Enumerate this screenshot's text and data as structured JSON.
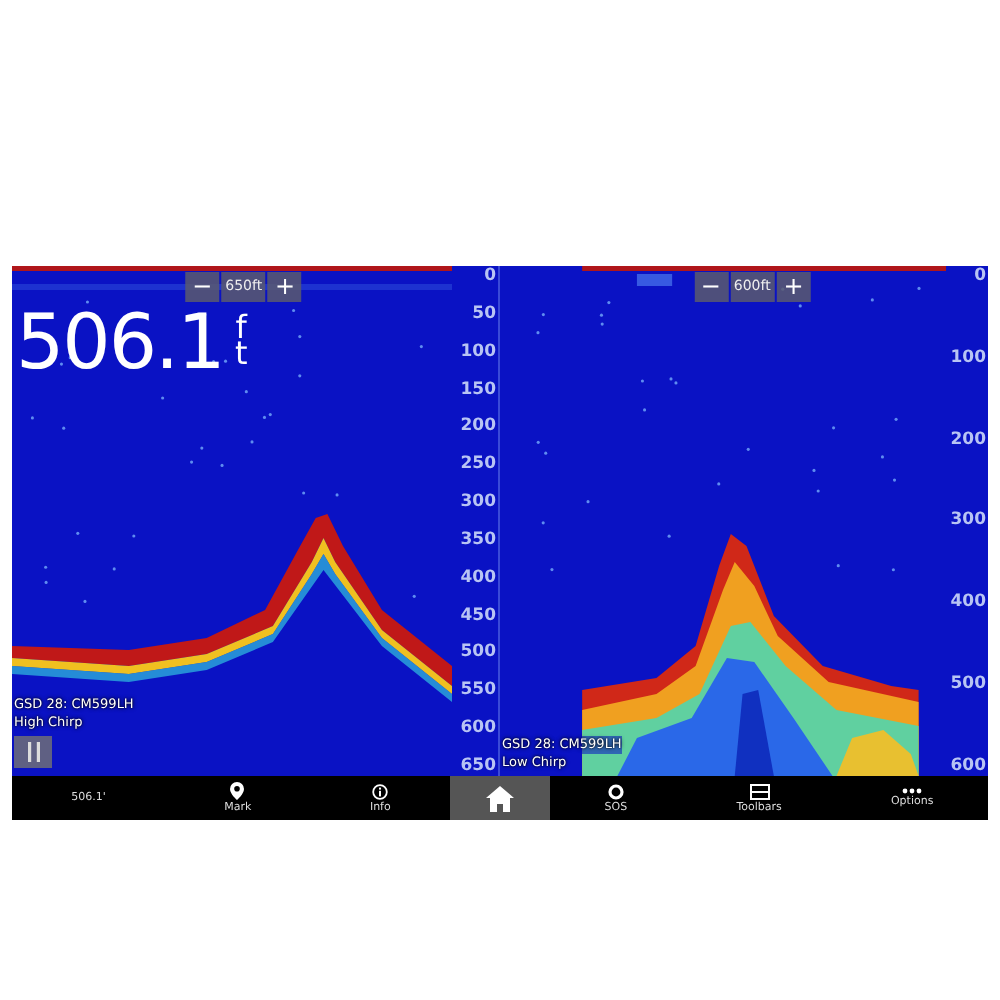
{
  "panels": [
    {
      "zoom_out": "−",
      "range": "650ft",
      "zoom_in": "+",
      "depth_reading": {
        "value": "506.1",
        "unit": "ft"
      },
      "scale": [
        "0",
        "50",
        "100",
        "150",
        "200",
        "250",
        "300",
        "350",
        "400",
        "450",
        "500",
        "550",
        "600",
        "650"
      ],
      "source": "GSD 28: CM599LH",
      "mode": "High Chirp",
      "paused": false,
      "kind": "high"
    },
    {
      "zoom_out": "−",
      "range": "600ft",
      "zoom_in": "+",
      "scale": [
        "0",
        "100",
        "200",
        "300",
        "400",
        "500",
        "600"
      ],
      "source": "GSD 28: CM599LH",
      "mode": "Low Chirp",
      "kind": "low"
    }
  ],
  "bottom_bar": {
    "left": [
      {
        "label": "506.1'",
        "kind": "text"
      },
      {
        "label": "Mark",
        "kind": "pin"
      },
      {
        "label": "Info",
        "kind": "info"
      }
    ],
    "right": [
      {
        "label": "SOS",
        "kind": "sos"
      },
      {
        "label": "Toolbars",
        "kind": "toolbars"
      },
      {
        "label": "Options",
        "kind": "options"
      }
    ]
  }
}
